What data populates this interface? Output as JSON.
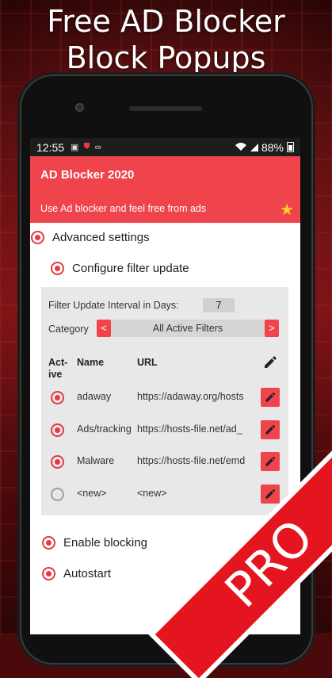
{
  "promo": {
    "headline_line1": "Free AD Blocker",
    "headline_line2": "Block Popups",
    "badge": "PRO"
  },
  "status_bar": {
    "time": "12:55",
    "battery": "88%"
  },
  "app_bar": {
    "title": "AD Blocker 2020",
    "subtitle": "Use Ad blocker and feel free from ads",
    "star_icon": "star-icon"
  },
  "settings": {
    "advanced": "Advanced settings",
    "configure_filter_update": "Configure filter update",
    "enable_blocking": "Enable blocking",
    "autostart": "Autostart"
  },
  "filter_panel": {
    "interval_label": "Filter Update Interval in Days:",
    "interval_value": "7",
    "category_label": "Category",
    "category_prev": "<",
    "category_value": "All Active Filters",
    "category_next": ">",
    "columns": {
      "active_line1": "Act-",
      "active_line2": "ive",
      "name": "Name",
      "url": "URL"
    },
    "rows": [
      {
        "name": "adaway",
        "url": "https://adaway.org/hosts",
        "active": true
      },
      {
        "name": "Ads/tracking",
        "url": "https://hosts-file.net/ad_",
        "active": true
      },
      {
        "name": "Malware",
        "url": "https://hosts-file.net/emd",
        "active": true
      },
      {
        "name": "<new>",
        "url": "<new>",
        "active": false
      }
    ]
  },
  "colors": {
    "accent": "#f0444c",
    "radio_on": "#e33a44",
    "radio_off": "#9aa0a6",
    "star": "#ffd21f"
  }
}
